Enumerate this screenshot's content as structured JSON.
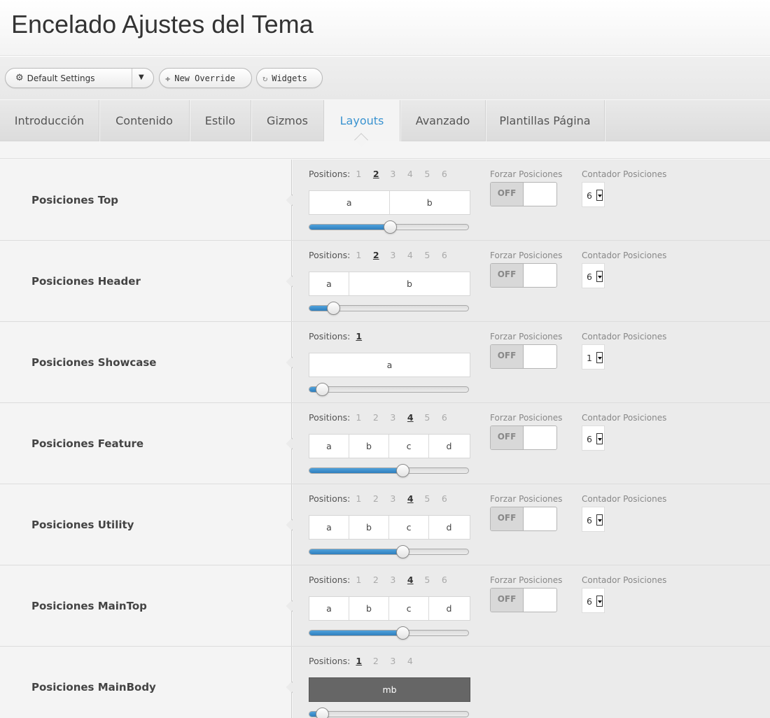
{
  "header": {
    "title": "Encelado Ajustes del Tema"
  },
  "toolbar": {
    "settings_select": {
      "label": "Default Settings",
      "icon": "gear-icon"
    },
    "new_override": {
      "label": "New Override",
      "icon": "plus-icon"
    },
    "widgets": {
      "label": "Widgets",
      "icon": "refresh-icon"
    }
  },
  "tabs": [
    {
      "label": "Introducción",
      "active": false
    },
    {
      "label": "Contenido",
      "active": false
    },
    {
      "label": "Estilo",
      "active": false
    },
    {
      "label": "Gizmos",
      "active": false
    },
    {
      "label": "Layouts",
      "active": true
    },
    {
      "label": "Avanzado",
      "active": false
    },
    {
      "label": "Plantillas Página",
      "active": false
    }
  ],
  "labels": {
    "positions": "Positions:",
    "forzar": "Forzar Posiciones",
    "contador": "Contador Posiciones",
    "toggle_off": "OFF"
  },
  "rows": [
    {
      "name": "Posiciones Top",
      "options": [
        "1",
        "2",
        "3",
        "4",
        "5",
        "6"
      ],
      "selected": "2",
      "cells": [
        "a",
        "b"
      ],
      "cell_widths": [
        0.5,
        0.5
      ],
      "slider_fraction": 0.5,
      "contador": "6",
      "has_controls": true,
      "dark": false
    },
    {
      "name": "Posiciones Header",
      "options": [
        "1",
        "2",
        "3",
        "4",
        "5",
        "6"
      ],
      "selected": "2",
      "cells": [
        "a",
        "b"
      ],
      "cell_widths": [
        0.25,
        0.75
      ],
      "slider_fraction": 0.15,
      "contador": "6",
      "has_controls": true,
      "dark": false
    },
    {
      "name": "Posiciones Showcase",
      "options": [
        "1"
      ],
      "selected": "1",
      "cells": [
        "a"
      ],
      "cell_widths": [
        1
      ],
      "slider_fraction": 0.08,
      "contador": "1",
      "has_controls": true,
      "dark": false
    },
    {
      "name": "Posiciones Feature",
      "options": [
        "1",
        "2",
        "3",
        "4",
        "5",
        "6"
      ],
      "selected": "4",
      "cells": [
        "a",
        "b",
        "c",
        "d"
      ],
      "cell_widths": [
        0.25,
        0.25,
        0.25,
        0.25
      ],
      "slider_fraction": 0.58,
      "contador": "6",
      "has_controls": true,
      "dark": false
    },
    {
      "name": "Posiciones Utility",
      "options": [
        "1",
        "2",
        "3",
        "4",
        "5",
        "6"
      ],
      "selected": "4",
      "cells": [
        "a",
        "b",
        "c",
        "d"
      ],
      "cell_widths": [
        0.25,
        0.25,
        0.25,
        0.25
      ],
      "slider_fraction": 0.58,
      "contador": "6",
      "has_controls": true,
      "dark": false
    },
    {
      "name": "Posiciones MainTop",
      "options": [
        "1",
        "2",
        "3",
        "4",
        "5",
        "6"
      ],
      "selected": "4",
      "cells": [
        "a",
        "b",
        "c",
        "d"
      ],
      "cell_widths": [
        0.25,
        0.25,
        0.25,
        0.25
      ],
      "slider_fraction": 0.58,
      "contador": "6",
      "has_controls": true,
      "dark": false
    },
    {
      "name": "Posiciones MainBody",
      "options": [
        "1",
        "2",
        "3",
        "4"
      ],
      "selected": "1",
      "cells": [
        "mb"
      ],
      "cell_widths": [
        1
      ],
      "slider_fraction": 0.08,
      "contador": "",
      "has_controls": false,
      "dark": true
    }
  ]
}
